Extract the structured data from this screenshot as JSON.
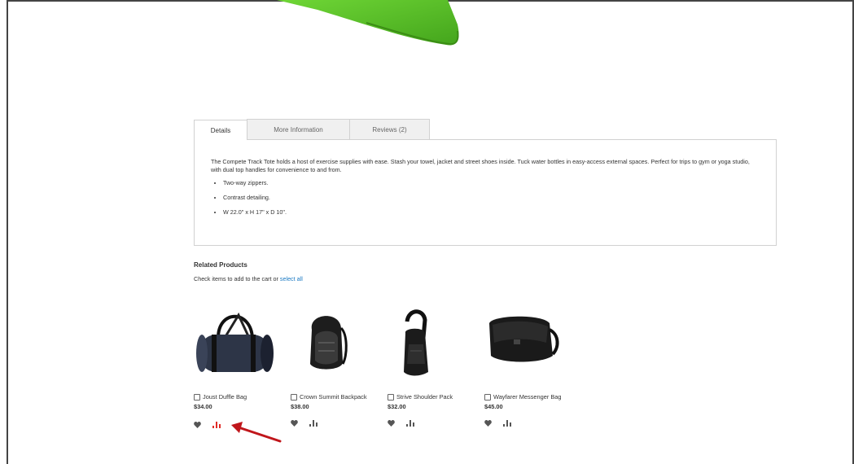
{
  "tabs": [
    {
      "label": "Details",
      "active": true
    },
    {
      "label": "More Information",
      "active": false
    },
    {
      "label": "Reviews (2)",
      "active": false
    }
  ],
  "details": {
    "description": "The Compete Track Tote holds a host of exercise supplies with ease. Stash your towel, jacket and street shoes inside. Tuck water bottles in easy-access external spaces. Perfect for trips to gym or yoga studio, with dual top handles for convenience to and from.",
    "features": [
      "Two-way zippers.",
      "Contrast detailing.",
      "W 22.0\" x H 17\" x D 10\"."
    ]
  },
  "related": {
    "title": "Related Products",
    "hint_prefix": "Check items to add to the cart or",
    "select_all": "select all",
    "products": [
      {
        "name": "Joust Duffle Bag",
        "price": "$34.00",
        "icon": "duffle-bag"
      },
      {
        "name": "Crown Summit Backpack",
        "price": "$38.00",
        "icon": "backpack"
      },
      {
        "name": "Strive Shoulder Pack",
        "price": "$32.00",
        "icon": "shoulder-pack"
      },
      {
        "name": "Wayfarer Messenger Bag",
        "price": "$45.00",
        "icon": "messenger-bag"
      }
    ]
  },
  "colors": {
    "accent_link": "#1979c3",
    "highlight_compare": "#e02b27",
    "annotation_arrow": "#c0161b",
    "tote_green": "#5fc72a"
  }
}
